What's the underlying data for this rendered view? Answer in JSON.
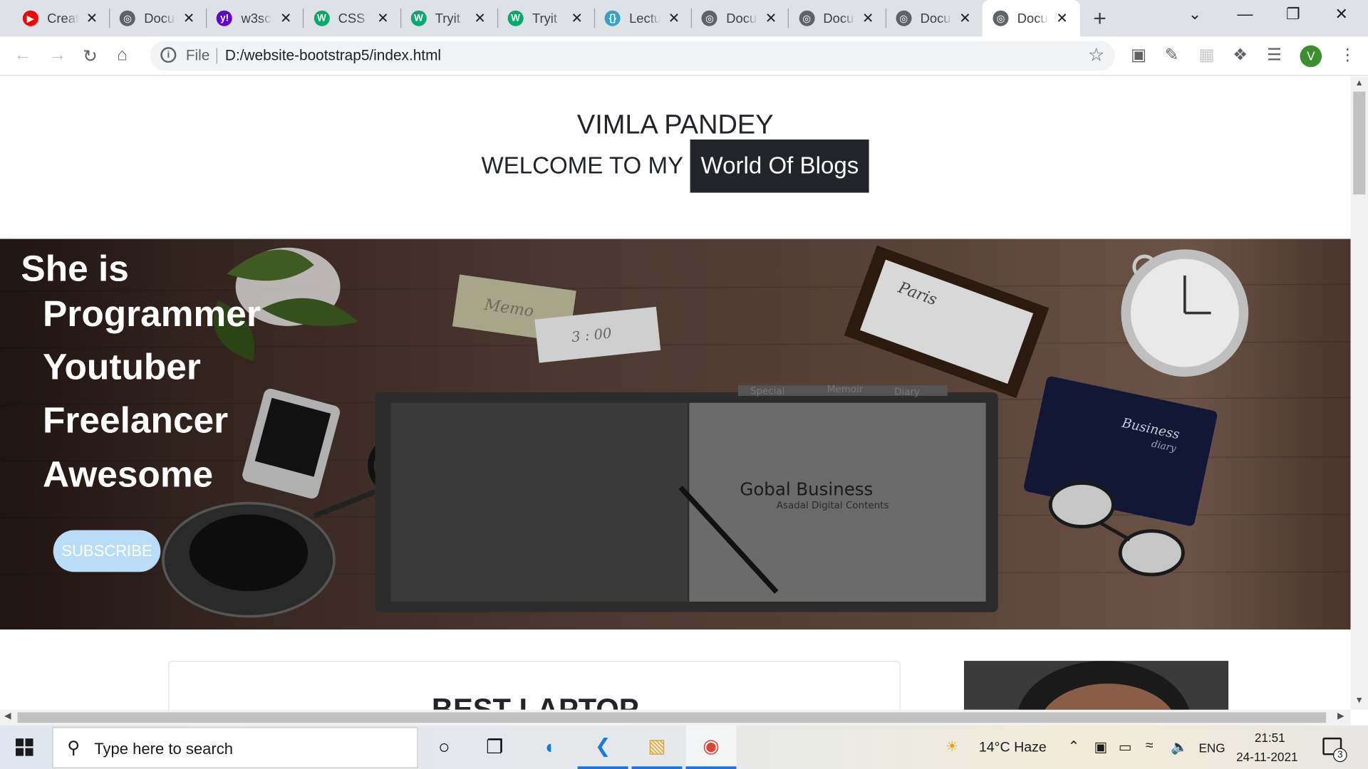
{
  "browser": {
    "tabs": [
      {
        "title": "Creat",
        "icon": "youtube-icon",
        "color": "#ff0000"
      },
      {
        "title": "Docu",
        "icon": "globe-icon",
        "color": "#5f6368"
      },
      {
        "title": "w3sc",
        "icon": "yahoo-icon",
        "color": "#6001d2"
      },
      {
        "title": "CSS f",
        "icon": "w3schools-icon",
        "color": "#04aa6d"
      },
      {
        "title": "Tryit",
        "icon": "w3schools-icon",
        "color": "#04aa6d"
      },
      {
        "title": "Tryit",
        "icon": "w3schools-icon",
        "color": "#04aa6d"
      },
      {
        "title": "Lectu",
        "icon": "code-icon",
        "color": "#34a2c3"
      },
      {
        "title": "Docu",
        "icon": "globe-icon",
        "color": "#5f6368"
      },
      {
        "title": "Docu",
        "icon": "globe-icon",
        "color": "#5f6368"
      },
      {
        "title": "Docu",
        "icon": "globe-icon",
        "color": "#5f6368"
      },
      {
        "title": "Docu",
        "icon": "globe-icon",
        "color": "#5f6368"
      }
    ],
    "active_tab_index": 10,
    "omnibox": {
      "scheme_label": "File",
      "url": "D:/website-bootstrap5/index.html"
    },
    "profile_initial": "V"
  },
  "page": {
    "site_name": "VIMLA PANDEY",
    "welcome": "WELCOME TO MY",
    "welcome_badge": "World Of Blogs",
    "hero": {
      "title": "She is",
      "roles": [
        "Programmer",
        "Youtuber",
        "Freelancer",
        "Awesome"
      ],
      "subscribe_label": "SUBSCRIBE",
      "book_title": "Gobal Business",
      "book_subtitle": "Asadal Digital Contents",
      "diary_title": "Business",
      "diary_subtitle": "diary",
      "tabs": [
        "Special",
        "Memoir",
        "Diary"
      ],
      "memo": "Memo",
      "note_time": "3 : 00",
      "frame_text": "Paris"
    },
    "card_title": "BEST LAPTOP"
  },
  "taskbar": {
    "search_placeholder": "Type here to search",
    "weather": "14°C  Haze",
    "language": "ENG",
    "time": "21:51",
    "date": "24-11-2021",
    "notification_count": "3"
  }
}
